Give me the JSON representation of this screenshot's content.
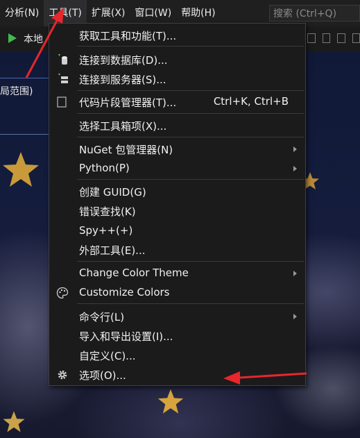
{
  "menubar": {
    "items": [
      {
        "label": "分析(N)"
      },
      {
        "label": "工具(T)"
      },
      {
        "label": "扩展(X)"
      },
      {
        "label": "窗口(W)"
      },
      {
        "label": "帮助(H)"
      }
    ],
    "search_placeholder": "搜索 (Ctrl+Q)"
  },
  "toolbar": {
    "run_label": "本地"
  },
  "left_panel": {
    "scope_label": "局范围)"
  },
  "tools_menu": {
    "items": [
      {
        "label": "获取工具和功能(T)...",
        "icon": "none"
      },
      {
        "label": "连接到数据库(D)...",
        "icon": "database-connect-icon"
      },
      {
        "label": "连接到服务器(S)...",
        "icon": "server-connect-icon"
      },
      {
        "label": "代码片段管理器(T)...",
        "shortcut": "Ctrl+K, Ctrl+B",
        "icon": "snippet-icon"
      },
      {
        "label": "选择工具箱项(X)...",
        "icon": "none"
      },
      {
        "label": "NuGet 包管理器(N)",
        "submenu": true
      },
      {
        "label": "Python(P)",
        "submenu": true
      },
      {
        "label": "创建 GUID(G)"
      },
      {
        "label": "错误查找(K)"
      },
      {
        "label": "Spy++(+)"
      },
      {
        "label": "外部工具(E)..."
      },
      {
        "label": "Change Color Theme",
        "submenu": true
      },
      {
        "label": "Customize Colors",
        "icon": "palette-icon"
      },
      {
        "label": "命令行(L)",
        "submenu": true
      },
      {
        "label": "导入和导出设置(I)..."
      },
      {
        "label": "自定义(C)..."
      },
      {
        "label": "选项(O)...",
        "icon": "gear-icon"
      }
    ]
  },
  "colors": {
    "menu_bg": "#1b1b1c",
    "menubar_bg": "#1f1f1f",
    "annotation_red": "#e8262b"
  }
}
